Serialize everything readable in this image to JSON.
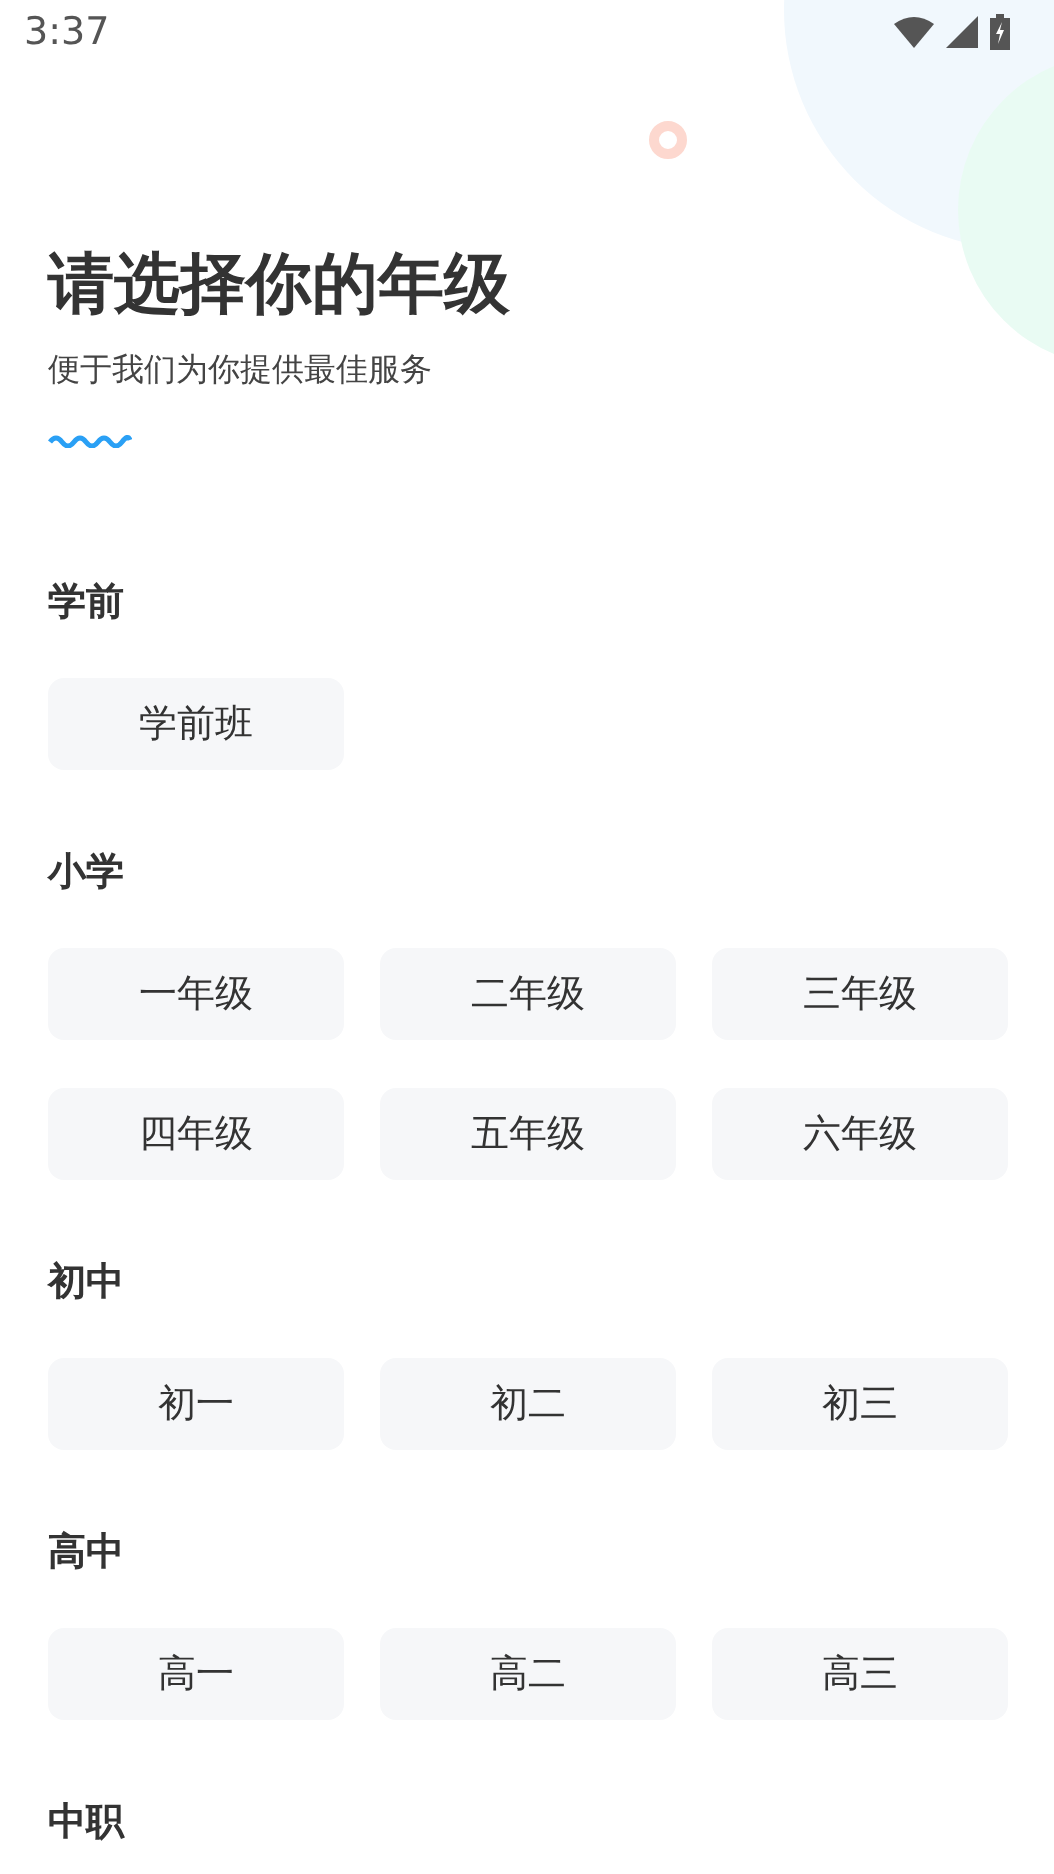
{
  "status_bar": {
    "time": "3:37"
  },
  "header": {
    "title": "请选择你的年级",
    "subtitle": "便于我们为你提供最佳服务"
  },
  "sections": [
    {
      "label": "学前",
      "options": [
        {
          "label": "学前班",
          "selected": false
        }
      ]
    },
    {
      "label": "小学",
      "options": [
        {
          "label": "一年级",
          "selected": false
        },
        {
          "label": "二年级",
          "selected": false
        },
        {
          "label": "三年级",
          "selected": false
        },
        {
          "label": "四年级",
          "selected": false
        },
        {
          "label": "五年级",
          "selected": false
        },
        {
          "label": "六年级",
          "selected": false
        }
      ]
    },
    {
      "label": "初中",
      "options": [
        {
          "label": "初一",
          "selected": false
        },
        {
          "label": "初二",
          "selected": false
        },
        {
          "label": "初三",
          "selected": false
        }
      ]
    },
    {
      "label": "高中",
      "options": [
        {
          "label": "高一",
          "selected": false
        },
        {
          "label": "高二",
          "selected": false
        },
        {
          "label": "高三",
          "selected": false
        }
      ]
    },
    {
      "label": "中职"
    }
  ]
}
